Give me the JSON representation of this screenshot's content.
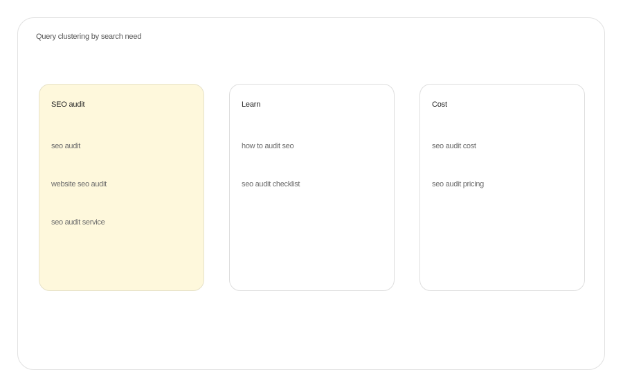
{
  "diagram": {
    "title": "Query clustering by search need",
    "clusters": [
      {
        "label": "SEO audit",
        "highlighted": true,
        "queries": [
          "seo audit",
          "website seo audit",
          "seo audit service"
        ]
      },
      {
        "label": "Learn",
        "highlighted": false,
        "queries": [
          "how to audit seo",
          "seo audit checklist"
        ]
      },
      {
        "label": "Cost",
        "highlighted": false,
        "queries": [
          "seo audit cost",
          "seo audit pricing"
        ]
      }
    ]
  },
  "colors": {
    "highlight_fill": "#fef8dc",
    "border": "#dedede",
    "text_primary": "#222222",
    "text_secondary": "#6a6a6a"
  }
}
